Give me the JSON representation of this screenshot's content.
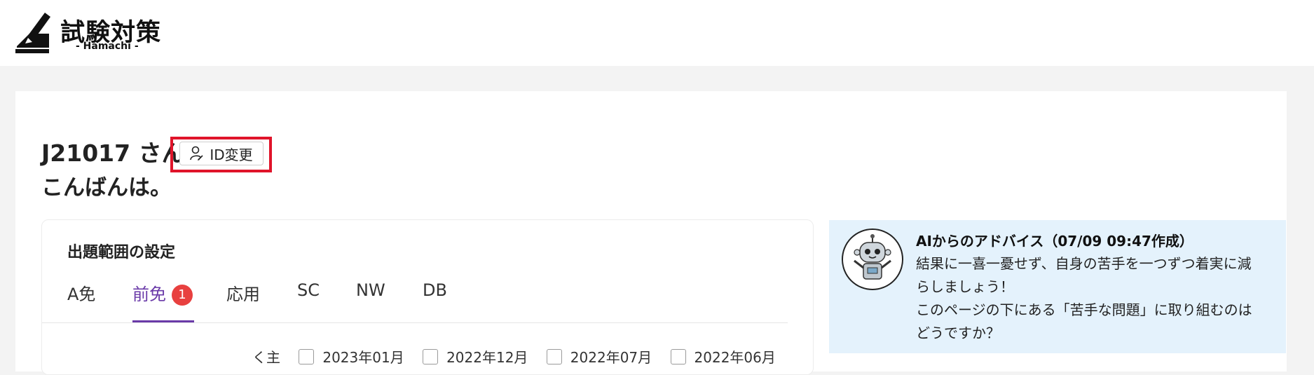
{
  "header": {
    "logo_title": "試験対策",
    "logo_subtitle": "- Hamachi -"
  },
  "greeting": {
    "name_line": "J21017 さん",
    "message": "こんばんは。",
    "id_change_label": "ID変更"
  },
  "settings": {
    "title": "出題範囲の設定",
    "tabs": [
      {
        "label": "A免"
      },
      {
        "label": "前免",
        "badge": "1",
        "active": true
      },
      {
        "label": "応用"
      },
      {
        "label": "SC"
      },
      {
        "label": "NW"
      },
      {
        "label": "DB"
      }
    ],
    "exam_dates": [
      "2023年01月",
      "2022年12月",
      "2022年07月",
      "2022年06月"
    ],
    "partial_prefix": "く主"
  },
  "advice": {
    "title": "AIからのアドバイス（07/09 09:47作成）",
    "lines": [
      "結果に一喜一憂せず、自身の苦手を一つずつ着実に減",
      "らしましょう！",
      "このページの下にある「苦手な問題」に取り組むのは",
      "どうですか？"
    ]
  },
  "colors": {
    "accent_purple": "#6a3aa8",
    "badge_red": "#e8403f",
    "highlight_red": "#e0142a",
    "advice_bg": "#e4f2fc"
  }
}
